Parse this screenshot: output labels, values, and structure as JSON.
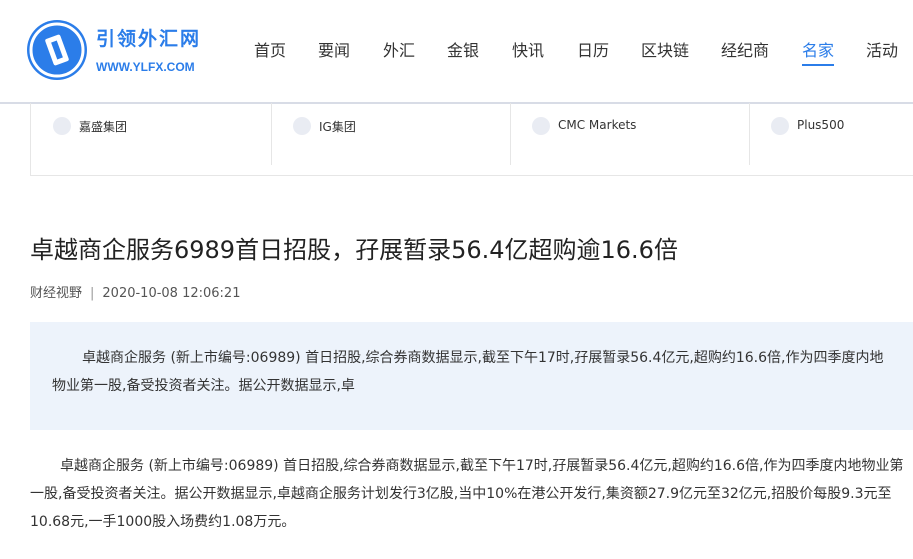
{
  "site": {
    "name_cn": "引领外汇网",
    "name_en": "WWW.YLFX.COM"
  },
  "nav": [
    "首页",
    "要闻",
    "外汇",
    "金银",
    "快讯",
    "日历",
    "区块链",
    "经纪商",
    "名家",
    "活动"
  ],
  "nav_active": "名家",
  "brokers": [
    "嘉盛集团",
    "IG集团",
    "CMC Markets",
    "Plus500"
  ],
  "article": {
    "title": "卓越商企服务6989首日招股，孖展暂录56.4亿超购逾16.6倍",
    "source": "财经视野",
    "datetime": "2020-10-08 12:06:21",
    "summary": "卓越商企服务 (新上市编号:06989) 首日招股,综合券商数据显示,截至下午17时,孖展暂录56.4亿元,超购约16.6倍,作为四季度内地物业第一股,备受投资者关注。据公开数据显示,卓",
    "body": "卓越商企服务 (新上市编号:06989) 首日招股,综合券商数据显示,截至下午17时,孖展暂录56.4亿元,超购约16.6倍,作为四季度内地物业第一股,备受投资者关注。据公开数据显示,卓越商企服务计划发行3亿股,当中10%在港公开发行,集资额27.9亿元至32亿元,招股价每股9.3元至10.68元,一手1000股入场费约1.08万元。"
  },
  "colors": {
    "accent": "#2b7de9",
    "summary_bg": "#edf3fb"
  }
}
